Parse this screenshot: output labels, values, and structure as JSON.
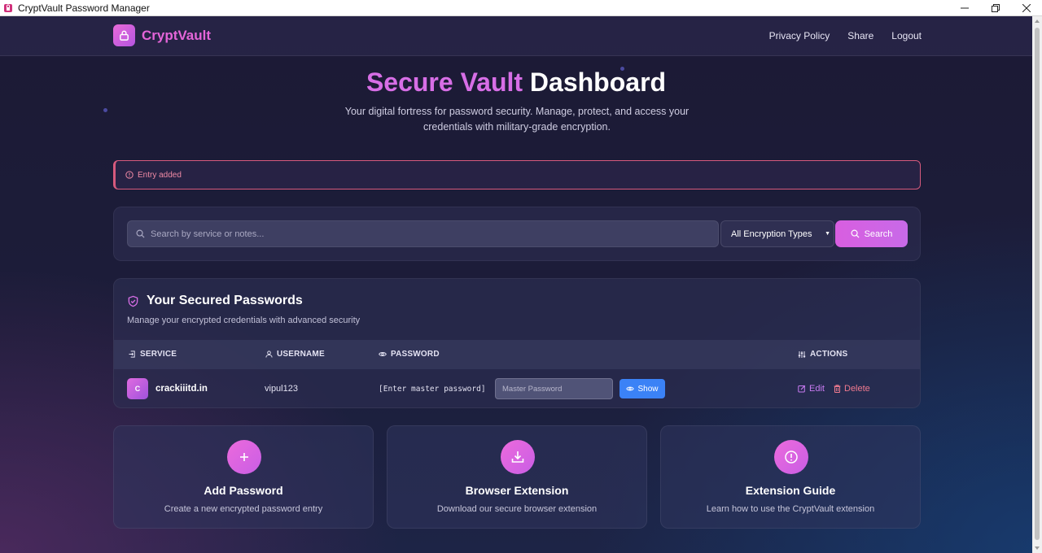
{
  "window": {
    "title": "CryptVault Password Manager",
    "controls": [
      "minimize",
      "restore",
      "close"
    ]
  },
  "navbar": {
    "logo_text": "CryptVault",
    "links": [
      "Privacy Policy",
      "Share",
      "Logout"
    ]
  },
  "hero": {
    "title_accent": "Secure Vault",
    "title_rest": "Dashboard",
    "subtitle": "Your digital fortress for password security. Manage, protect, and access your credentials with military-grade encryption."
  },
  "alert": {
    "message": "Entry added"
  },
  "search": {
    "placeholder": "Search by service or notes...",
    "filter_selected": "All Encryption Types",
    "button_label": "Search"
  },
  "passwords": {
    "title": "Your Secured Passwords",
    "subtitle": "Manage your encrypted credentials with advanced security",
    "columns": [
      "SERVICE",
      "USERNAME",
      "PASSWORD",
      "ACTIONS"
    ],
    "rows": [
      {
        "avatar_letter": "C",
        "service": "crackiiitd.in",
        "username": "vipul123",
        "password_masked": "[Enter master password]",
        "master_placeholder": "Master Password",
        "show_label": "Show",
        "edit_label": "Edit",
        "delete_label": "Delete"
      }
    ]
  },
  "features": [
    {
      "icon": "plus-icon",
      "title": "Add Password",
      "desc": "Create a new encrypted password entry"
    },
    {
      "icon": "download-icon",
      "title": "Browser Extension",
      "desc": "Download our secure browser extension"
    },
    {
      "icon": "info-icon",
      "title": "Extension Guide",
      "desc": "Learn how to use the CryptVault extension"
    }
  ],
  "colors": {
    "accent_pink": "#d76ee6",
    "show_button": "#3b82f6",
    "alert_border": "#d65a7d",
    "delete_text": "#f07a8f"
  }
}
